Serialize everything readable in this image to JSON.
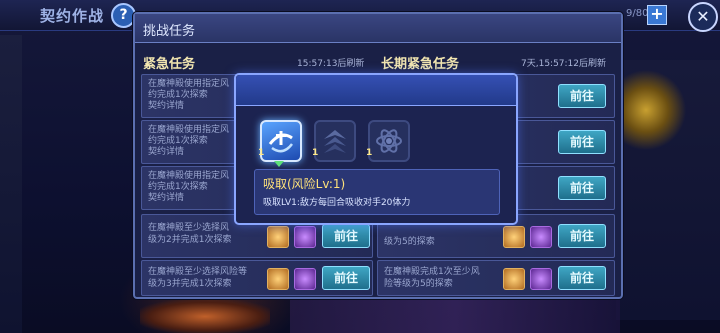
{
  "background": {
    "title": "契约作战",
    "help_label": "?",
    "counter": "9/80",
    "plus_label": "+",
    "close_label": "✕"
  },
  "panel": {
    "title": "挑战任务",
    "urgent": {
      "title": "紧急任务",
      "timer": "15:57:13后刷新"
    },
    "long_urgent": {
      "title": "长期紧急任务",
      "timer": "7天,15:57:12后刷新"
    },
    "go_label": "前往",
    "left_rows": [
      {
        "line1": "在魔神殿使用指定风",
        "line2": "约完成1次探索",
        "line3": "契约详情"
      },
      {
        "line1": "在魔神殿使用指定风",
        "line2": "约完成1次探索",
        "line3": "契约详情"
      },
      {
        "line1": "在魔神殿使用指定风",
        "line2": "约完成1次探索",
        "line3": "契约详情"
      },
      {
        "line1": "在魔神殿至少选择风",
        "line2": "级为2并完成1次探索",
        "line3": ""
      },
      {
        "line1": "在魔神殿至少选择风险等",
        "line2": "级为3并完成1次探索",
        "line3": ""
      }
    ],
    "right_rows": [
      {
        "line1": "",
        "line2": ""
      },
      {
        "line1": "",
        "line2": ""
      },
      {
        "line1": "",
        "line2": ""
      },
      {
        "line1": "",
        "line2": "级为5的探索"
      },
      {
        "line1": "在魔神殿完成1次至少风",
        "line2": "险等级为5的探索"
      }
    ]
  },
  "popup": {
    "skills": [
      {
        "icon": "absorb-icon",
        "level": "1"
      },
      {
        "icon": "rank-chevron-icon",
        "level": "1"
      },
      {
        "icon": "atom-icon",
        "level": "1"
      }
    ],
    "skill_name": "吸取(风险Lv:1)",
    "skill_desc": "吸取LV1:敌方每回合吸收对手20体力"
  }
}
